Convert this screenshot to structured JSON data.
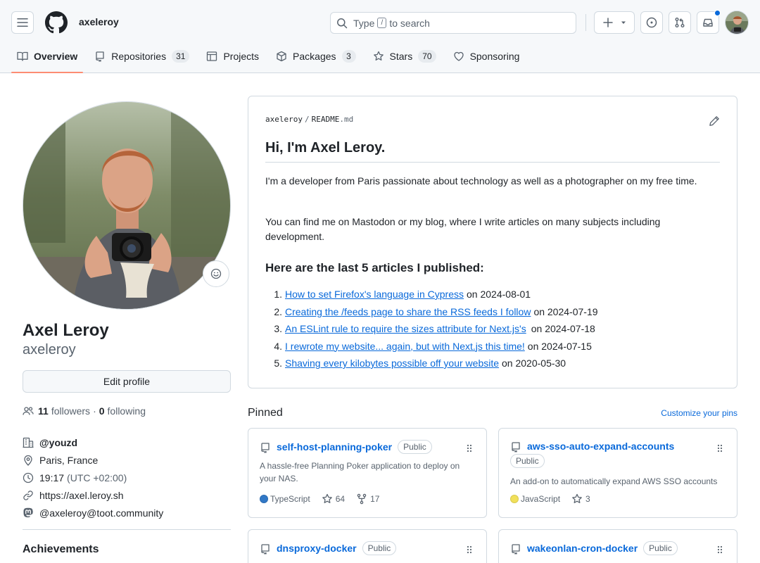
{
  "header": {
    "username": "axeleroy",
    "search_prefix": "Type",
    "search_key": "/",
    "search_suffix": "to search"
  },
  "tabs": [
    {
      "label": "Overview",
      "active": true
    },
    {
      "label": "Repositories",
      "count": "31"
    },
    {
      "label": "Projects"
    },
    {
      "label": "Packages",
      "count": "3"
    },
    {
      "label": "Stars",
      "count": "70"
    },
    {
      "label": "Sponsoring"
    }
  ],
  "profile": {
    "full_name": "Axel Leroy",
    "login": "axeleroy",
    "edit_label": "Edit profile",
    "followers_count": "11",
    "followers_label": "followers",
    "dot": "·",
    "following_count": "0",
    "following_label": "following",
    "organization": "@youzd",
    "location": "Paris, France",
    "local_time": "19:17",
    "timezone": "(UTC +02:00)",
    "website": "https://axel.leroy.sh",
    "mastodon": "@axeleroy@toot.community",
    "achievements_title": "Achievements"
  },
  "readme": {
    "owner": "axeleroy",
    "separator": "/",
    "file_base": "README",
    "file_ext": ".md",
    "heading": "Hi, I'm Axel Leroy.",
    "paragraph1": "I'm a developer from Paris passionate about technology as well as a photographer on my free time.",
    "paragraph2": "You can find me on Mastodon or my blog, where I write articles on many subjects including development.",
    "subheading": "Here are the last 5 articles I published:",
    "articles": [
      {
        "num": "1.",
        "title": "How to set Firefox's language in Cypress",
        "date": "on 2024-08-01"
      },
      {
        "num": "2.",
        "title": "Creating the /feeds page to share the RSS feeds I follow",
        "date": "on 2024-07-19"
      },
      {
        "num": "3.",
        "title": "An ESLint rule to require the sizes attribute for Next.js's",
        "date": "on 2024-07-18"
      },
      {
        "num": "4.",
        "title": "I rewrote my website... again, but with Next.js this time!",
        "date": "on 2024-07-15"
      },
      {
        "num": "5.",
        "title": "Shaving every kilobytes possible off your website",
        "date": "on 2020-05-30"
      }
    ]
  },
  "pinned": {
    "title": "Pinned",
    "customize_label": "Customize your pins",
    "repos": [
      {
        "name": "self-host-planning-poker",
        "visibility": "Public",
        "description": "A hassle-free Planning Poker application to deploy on your NAS.",
        "language": "TypeScript",
        "lang_color": "#3178c6",
        "stars": "64",
        "forks": "17"
      },
      {
        "name": "aws-sso-auto-expand-accounts",
        "visibility": "Public",
        "description": "An add-on to automatically expand AWS SSO accounts",
        "language": "JavaScript",
        "lang_color": "#f1e05a",
        "stars": "3"
      },
      {
        "name": "dnsproxy-docker",
        "visibility": "Public"
      },
      {
        "name": "wakeonlan-cron-docker",
        "visibility": "Public"
      }
    ]
  },
  "colors": {
    "accent": "#0969da",
    "tab_underline": "#fd8c73",
    "border": "#d1d9e0",
    "muted": "#59636e"
  }
}
